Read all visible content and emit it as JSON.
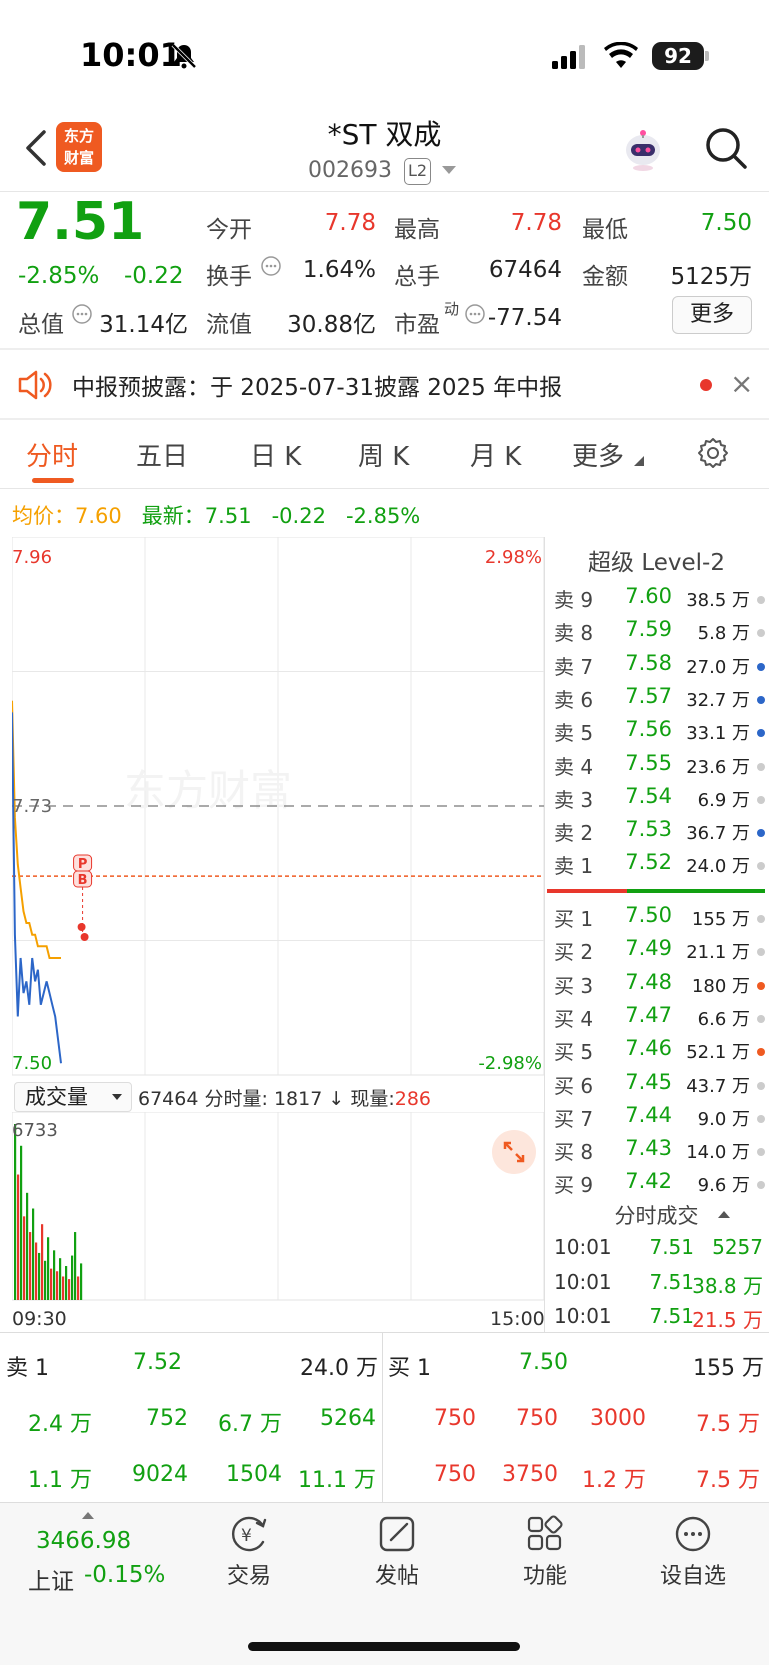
{
  "status_bar": {
    "time": "10:01",
    "battery": "92"
  },
  "header": {
    "logo_text_1": "东方",
    "logo_text_2": "财富",
    "stock_name": "*ST 双成",
    "stock_code": "002693",
    "l2_badge": "L2"
  },
  "quote": {
    "price": "7.51",
    "change_pct": "-2.85%",
    "change_abs": "-0.22",
    "fields": [
      {
        "label": "今开",
        "value": "7.78",
        "color": "red"
      },
      {
        "label": "最高",
        "value": "7.78",
        "color": "red"
      },
      {
        "label": "最低",
        "value": "7.50",
        "color": "green"
      },
      {
        "label": "换手",
        "value": "1.64%",
        "color": "black"
      },
      {
        "label": "总手",
        "value": "67464",
        "color": "black"
      },
      {
        "label": "金额",
        "value": "5125万",
        "color": "black"
      },
      {
        "label": "总值",
        "value": "31.14亿",
        "color": "black"
      },
      {
        "label": "流值",
        "value": "30.88亿",
        "color": "black"
      },
      {
        "label": "市盈",
        "superscript": "动",
        "value": "-77.54",
        "color": "black"
      }
    ],
    "more_label": "更多"
  },
  "notice": {
    "text": "中报预披露：于 2025-07-31披露 2025 年中报"
  },
  "tabs": [
    "分时",
    "五日",
    "日 K",
    "周 K",
    "月 K",
    "更多"
  ],
  "intraday_info": {
    "avg_label": "均价：",
    "avg_value": "7.60",
    "latest_label": "最新：",
    "latest_value": "7.51",
    "latest_change": "-0.22",
    "latest_pct": "-2.85%"
  },
  "chart_data": {
    "type": "line",
    "title": "",
    "x_labels": [
      "09:30",
      "15:00"
    ],
    "y_top_label": "7.96",
    "y_bottom_label": "7.50",
    "y_ref_label": "7.73",
    "pct_top_label": "2.98%",
    "pct_bottom_label": "-2.98%",
    "ylim": [
      7.5,
      7.96
    ],
    "prev_close": 7.73,
    "series": [
      {
        "values": [
          7.81,
          7.62,
          7.55,
          7.6,
          7.57,
          7.58,
          7.56,
          7.6,
          7.58,
          7.59,
          7.56,
          7.57,
          7.58,
          7.57,
          7.56,
          7.55,
          7.53,
          7.51
        ],
        "color": "#2c66c8"
      },
      {
        "values": [
          7.82,
          7.72,
          7.68,
          7.66,
          7.64,
          7.63,
          7.63,
          7.62,
          7.62,
          7.61,
          7.61,
          7.61,
          7.61,
          7.6,
          7.6,
          7.6,
          7.6,
          7.6
        ],
        "color": "#f5a000"
      }
    ],
    "markers": [
      {
        "label": "P",
        "value": 7.6
      },
      {
        "label": "B",
        "value": 7.58
      }
    ],
    "volume": {
      "max_label": "6733",
      "bars": [
        {
          "v": 6733,
          "c": "g"
        },
        {
          "v": 4800,
          "c": "r"
        },
        {
          "v": 5900,
          "c": "g"
        },
        {
          "v": 3200,
          "c": "r"
        },
        {
          "v": 4100,
          "c": "g"
        },
        {
          "v": 2600,
          "c": "r"
        },
        {
          "v": 3500,
          "c": "g"
        },
        {
          "v": 2200,
          "c": "r"
        },
        {
          "v": 1800,
          "c": "g"
        },
        {
          "v": 2900,
          "c": "r"
        },
        {
          "v": 1500,
          "c": "g"
        },
        {
          "v": 2400,
          "c": "g"
        },
        {
          "v": 1200,
          "c": "r"
        },
        {
          "v": 1900,
          "c": "g"
        },
        {
          "v": 1100,
          "c": "r"
        },
        {
          "v": 1600,
          "c": "g"
        },
        {
          "v": 900,
          "c": "r"
        },
        {
          "v": 1300,
          "c": "g"
        },
        {
          "v": 800,
          "c": "r"
        },
        {
          "v": 1700,
          "c": "g"
        },
        {
          "v": 2600,
          "c": "g"
        },
        {
          "v": 900,
          "c": "r"
        },
        {
          "v": 1400,
          "c": "g"
        }
      ]
    }
  },
  "volume_bar": {
    "select_label": "成交量",
    "total": "67464",
    "minute_label": "分时量:",
    "minute_value": "1817",
    "arrow": "↓",
    "now_label": "现量:",
    "now_value": "286"
  },
  "order_book": {
    "title": "超级 Level-2",
    "asks": [
      {
        "label": "卖 9",
        "price": "7.60",
        "vol": "38.5 万",
        "dot": "#cccccc"
      },
      {
        "label": "卖 8",
        "price": "7.59",
        "vol": "5.8 万",
        "dot": "#cccccc"
      },
      {
        "label": "卖 7",
        "price": "7.58",
        "vol": "27.0 万",
        "dot": "#2c66c8"
      },
      {
        "label": "卖 6",
        "price": "7.57",
        "vol": "32.7 万",
        "dot": "#2c66c8"
      },
      {
        "label": "卖 5",
        "price": "7.56",
        "vol": "33.1 万",
        "dot": "#2c66c8"
      },
      {
        "label": "卖 4",
        "price": "7.55",
        "vol": "23.6 万",
        "dot": "#cccccc"
      },
      {
        "label": "卖 3",
        "price": "7.54",
        "vol": "6.9 万",
        "dot": "#cccccc"
      },
      {
        "label": "卖 2",
        "price": "7.53",
        "vol": "36.7 万",
        "dot": "#2c66c8"
      },
      {
        "label": "卖 1",
        "price": "7.52",
        "vol": "24.0 万",
        "dot": "#cccccc"
      }
    ],
    "bids": [
      {
        "label": "买 1",
        "price": "7.50",
        "vol": "155 万",
        "dot": "#cccccc"
      },
      {
        "label": "买 2",
        "price": "7.49",
        "vol": "21.1 万",
        "dot": "#cccccc"
      },
      {
        "label": "买 3",
        "price": "7.48",
        "vol": "180 万",
        "dot": "#ef5a21"
      },
      {
        "label": "买 4",
        "price": "7.47",
        "vol": "6.6 万",
        "dot": "#cccccc"
      },
      {
        "label": "买 5",
        "price": "7.46",
        "vol": "52.1 万",
        "dot": "#ef5a21"
      },
      {
        "label": "买 6",
        "price": "7.45",
        "vol": "43.7 万",
        "dot": "#cccccc"
      },
      {
        "label": "买 7",
        "price": "7.44",
        "vol": "9.0 万",
        "dot": "#cccccc"
      },
      {
        "label": "买 8",
        "price": "7.43",
        "vol": "14.0 万",
        "dot": "#cccccc"
      },
      {
        "label": "买 9",
        "price": "7.42",
        "vol": "9.6 万",
        "dot": "#cccccc"
      }
    ]
  },
  "ticks": {
    "title": "分时成交",
    "rows": [
      {
        "time": "10:01",
        "price": "7.51",
        "vol": "5257",
        "vol_color": "green"
      },
      {
        "time": "10:01",
        "price": "7.51",
        "vol": "38.8 万",
        "vol_color": "green"
      },
      {
        "time": "10:01",
        "price": "7.51",
        "vol": "21.5 万",
        "vol_color": "red"
      }
    ]
  },
  "level1": {
    "ask_label": "卖 1",
    "ask_price": "7.52",
    "ask_vol": "24.0 万",
    "bid_label": "买 1",
    "bid_price": "7.50",
    "bid_vol": "155 万",
    "ask_queue": [
      [
        "2.4 万",
        "752",
        "6.7 万",
        "5264"
      ],
      [
        "1.1 万",
        "9024",
        "1504",
        "11.1 万"
      ]
    ],
    "bid_queue": [
      [
        "750",
        "750",
        "3000",
        "7.5 万"
      ],
      [
        "750",
        "3750",
        "1.2 万",
        "7.5 万"
      ]
    ]
  },
  "bottom_nav": {
    "index_value": "3466.98",
    "index_name": "上证",
    "index_change": "-0.15%",
    "items": [
      "交易",
      "发帖",
      "功能",
      "设自选"
    ]
  }
}
